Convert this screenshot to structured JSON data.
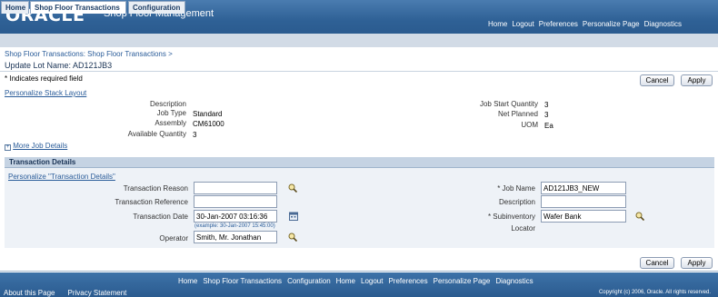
{
  "header": {
    "logo": "ORACLE",
    "app_title": "Shop Floor Management",
    "global_links": [
      "Home",
      "Logout",
      "Preferences",
      "Personalize Page",
      "Diagnostics"
    ]
  },
  "tabs": [
    "Home",
    "Shop Floor Transactions",
    "Configuration"
  ],
  "breadcrumb": "Shop Floor Transactions: Shop Floor Transactions >",
  "page_title": "Update Lot Name: AD121JB3",
  "required_note": "Indicates required field",
  "buttons": {
    "cancel": "Cancel",
    "apply": "Apply"
  },
  "personalize_stack": "Personalize Stack Layout",
  "job_info": {
    "description_label": "Description",
    "job_type_label": "Job Type",
    "job_type": "Standard",
    "assembly_label": "Assembly",
    "assembly": "CM61000",
    "available_qty_label": "Available Quantity",
    "available_qty": "3",
    "job_start_qty_label": "Job Start Quantity",
    "job_start_qty": "3",
    "net_planned_label": "Net Planned",
    "net_planned": "3",
    "uom_label": "UOM",
    "uom": "Ea"
  },
  "more_job_details": "More Job Details",
  "transaction_details": {
    "header": "Transaction Details",
    "personalize_link": "Personalize \"Transaction Details\"",
    "reason_label": "Transaction Reason",
    "reason_value": "",
    "reference_label": "Transaction Reference",
    "reference_value": "",
    "date_label": "Transaction Date",
    "date_value": "30-Jan-2007 03:16:36",
    "date_example": "(example: 30-Jan-2007 15:45:00)",
    "operator_label": "Operator",
    "operator_value": "Smith, Mr. Jonathan",
    "job_name_label": "Job Name",
    "job_name_value": "AD121JB3_NEW",
    "description_label": "Description",
    "description_value": "",
    "subinventory_label": "Subinventory",
    "subinventory_value": "Wafer Bank",
    "locator_label": "Locator"
  },
  "footer": {
    "links": [
      "Home",
      "Shop Floor Transactions",
      "Configuration",
      "Home",
      "Logout",
      "Preferences",
      "Personalize Page",
      "Diagnostics"
    ],
    "about": "About this Page",
    "privacy": "Privacy Statement",
    "copyright": "Copyright (c) 2006, Oracle. All rights reserved."
  }
}
